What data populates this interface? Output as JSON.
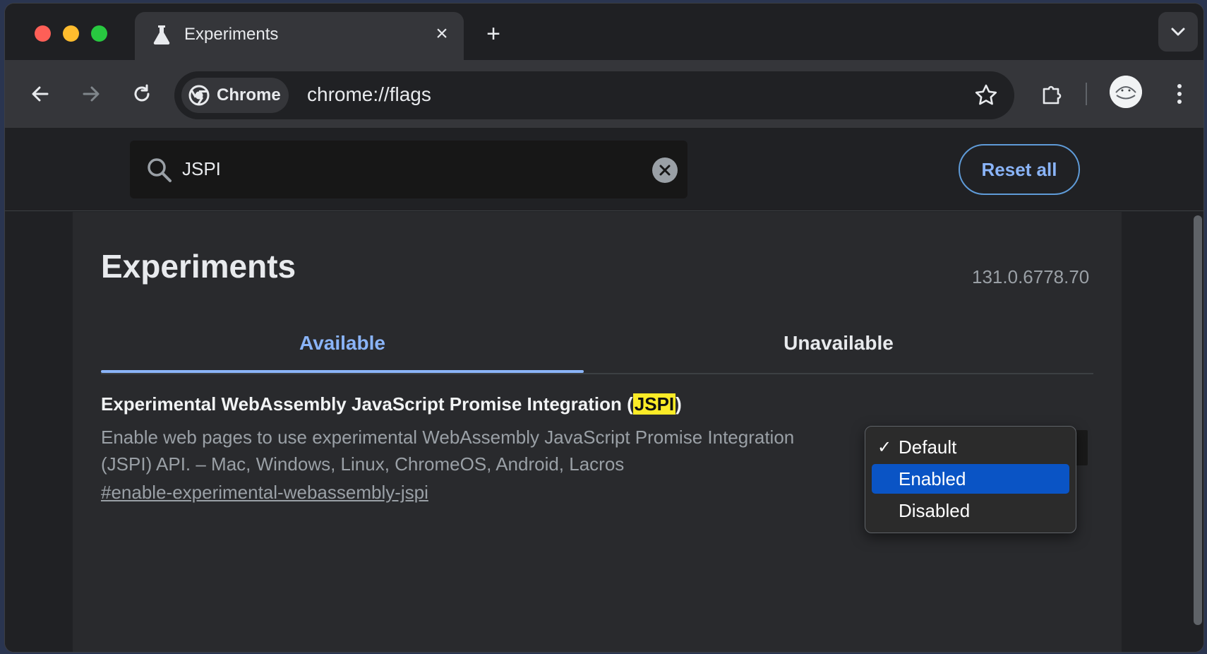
{
  "browser": {
    "tab_title": "Experiments",
    "tab_close": "×",
    "new_tab": "+",
    "chip_label": "Chrome",
    "url": "chrome://flags"
  },
  "flags": {
    "search_value": "JSPI",
    "reset_label": "Reset all",
    "page_title": "Experiments",
    "version": "131.0.6778.70",
    "tabs": [
      {
        "label": "Available",
        "active": true
      },
      {
        "label": "Unavailable",
        "active": false
      }
    ],
    "experiment": {
      "title_prefix": "Experimental WebAssembly JavaScript Promise Integration (",
      "title_highlight": "JSPI",
      "title_suffix": ")",
      "description": "Enable web pages to use experimental WebAssembly JavaScript Promise Integration (JSPI) API. – Mac, Windows, Linux, ChromeOS, Android, Lacros",
      "link": "#enable-experimental-webassembly-jspi"
    },
    "dropdown": {
      "check": "✓",
      "options": [
        "Default",
        "Enabled",
        "Disabled"
      ],
      "checked": "Default",
      "highlighted": "Enabled"
    }
  },
  "colors": {
    "accent": "#8ab4f8",
    "highlight": "#fbeb27",
    "selection": "#0a54c5"
  }
}
